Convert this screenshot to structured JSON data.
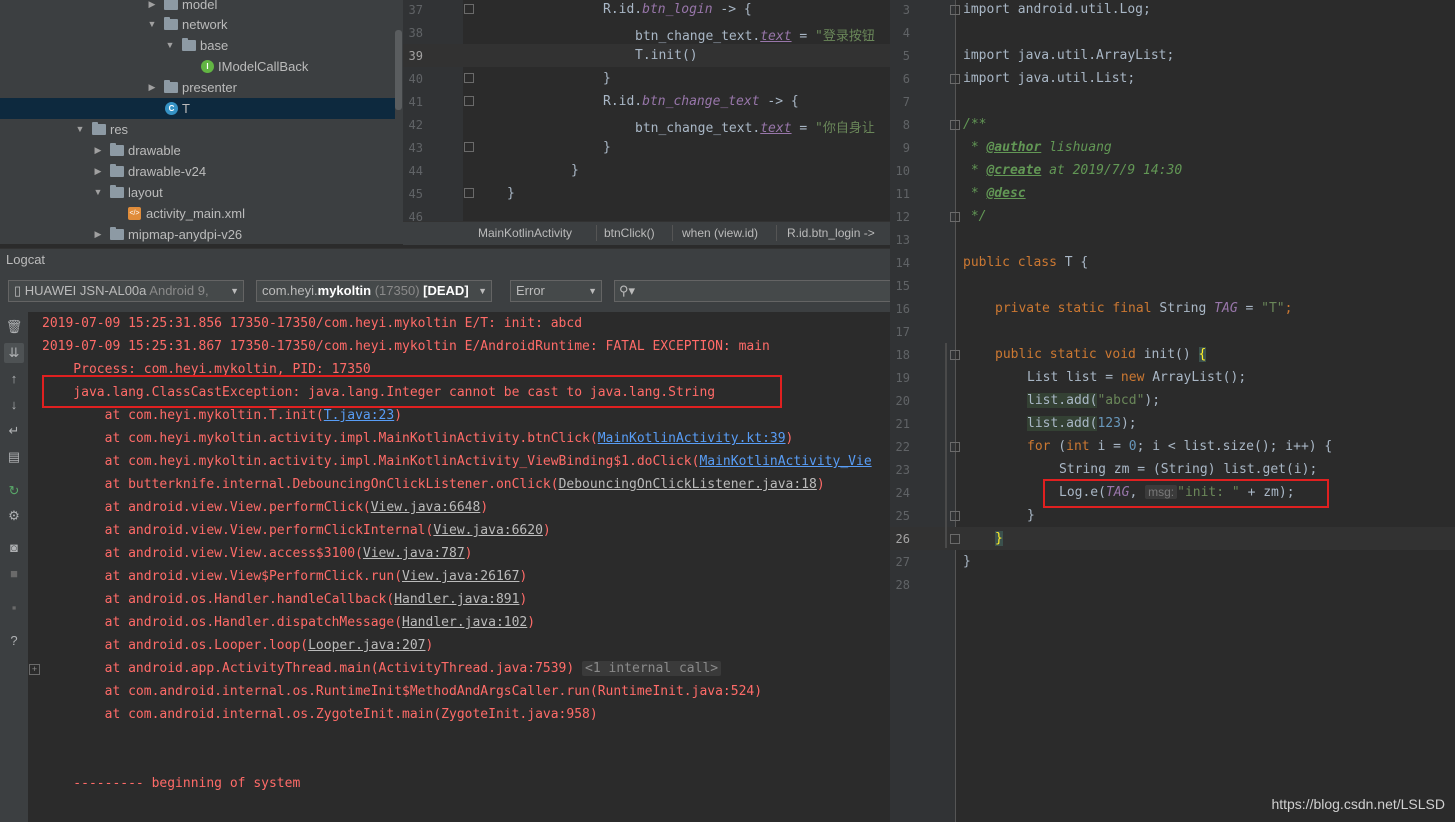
{
  "project_tree": {
    "items": [
      {
        "label": "model",
        "type": "folder",
        "expanded": false
      },
      {
        "label": "network",
        "type": "folder",
        "expanded": true
      },
      {
        "label": "base",
        "type": "folder",
        "expanded": true
      },
      {
        "label": "IModelCallBack",
        "type": "interface"
      },
      {
        "label": "presenter",
        "type": "folder",
        "expanded": false
      },
      {
        "label": "T",
        "type": "class",
        "selected": true
      },
      {
        "label": "res",
        "type": "res-folder",
        "expanded": true
      },
      {
        "label": "drawable",
        "type": "folder",
        "expanded": false
      },
      {
        "label": "drawable-v24",
        "type": "folder",
        "expanded": false
      },
      {
        "label": "layout",
        "type": "folder",
        "expanded": true
      },
      {
        "label": "activity_main.xml",
        "type": "xml"
      },
      {
        "label": "mipmap-anydpi-v26",
        "type": "folder",
        "expanded": false
      }
    ]
  },
  "top_editor": {
    "line_numbers": [
      "37",
      "38",
      "39",
      "40",
      "41",
      "42",
      "43",
      "44",
      "45",
      "46"
    ],
    "lines": [
      {
        "a": "R.id.",
        "b": "btn_login",
        "c": " -> {"
      },
      {
        "a": "btn_change_text.",
        "b": "text",
        "c": " = ",
        "d": "\"登录按钮"
      },
      {
        "a": "T.init()"
      },
      {
        "a": "}"
      },
      {
        "a": "R.id.",
        "b": "btn_change_text",
        "c": " -> {"
      },
      {
        "a": "btn_change_text.",
        "b": "text",
        "c": " = ",
        "d": "\"你自身让"
      },
      {
        "a": "}"
      },
      {
        "a": "}"
      },
      {
        "a": "}"
      },
      {
        "a": ""
      }
    ],
    "breadcrumbs": [
      "MainKotlinActivity",
      "btnClick()",
      "when (view.id)",
      "R.id.btn_login ->"
    ]
  },
  "logcat": {
    "title": "Logcat",
    "device": {
      "name": "HUAWEI JSN-AL00a",
      "detail": "Android 9, "
    },
    "process": {
      "prefix": "com.heyi.",
      "bold": "mykoltin",
      "pid": " (17350) ",
      "state": "[DEAD]"
    },
    "level": "Error",
    "search_placeholder": "",
    "lines": [
      {
        "text": "2019-07-09 15:25:31.856 17350-17350/com.heyi.mykoltin E/T: init: abcd"
      },
      {
        "text": "2019-07-09 15:25:31.867 17350-17350/com.heyi.mykoltin E/AndroidRuntime: FATAL EXCEPTION: main"
      },
      {
        "text": "    Process: com.heyi.mykoltin, PID: 17350"
      },
      {
        "text": "    java.lang.ClassCastException: java.lang.Integer cannot be cast to java.lang.String"
      },
      {
        "text": "        at com.heyi.mykoltin.T.init(",
        "link": "T.java:23",
        "tail": ")"
      },
      {
        "text": "        at com.heyi.mykoltin.activity.impl.MainKotlinActivity.btnClick(",
        "link": "MainKotlinActivity.kt:39",
        "tail": ")"
      },
      {
        "text": "        at com.heyi.mykoltin.activity.impl.MainKotlinActivity_ViewBinding$1.doClick(",
        "link": "MainKotlinActivity_Vie",
        "tail": ""
      },
      {
        "text": "        at butterknife.internal.DebouncingOnClickListener.onClick(",
        "src": "DebouncingOnClickListener.java:18",
        "tail": ")"
      },
      {
        "text": "        at android.view.View.performClick(",
        "src": "View.java:6648",
        "tail": ")"
      },
      {
        "text": "        at android.view.View.performClickInternal(",
        "src": "View.java:6620",
        "tail": ")"
      },
      {
        "text": "        at android.view.View.access$3100(",
        "src": "View.java:787",
        "tail": ")"
      },
      {
        "text": "        at android.view.View$PerformClick.run(",
        "src": "View.java:26167",
        "tail": ")"
      },
      {
        "text": "        at android.os.Handler.handleCallback(",
        "src": "Handler.java:891",
        "tail": ")"
      },
      {
        "text": "        at android.os.Handler.dispatchMessage(",
        "src": "Handler.java:102",
        "tail": ")"
      },
      {
        "text": "        at android.os.Looper.loop(",
        "src": "Looper.java:207",
        "tail": ")"
      },
      {
        "text": "        at android.app.ActivityThread.main(ActivityThread.java:7539) ",
        "fold": "<1 internal call>"
      },
      {
        "text": "        at com.android.internal.os.RuntimeInit$MethodAndArgsCaller.run(RuntimeInit.java:524)"
      },
      {
        "text": "        at com.android.internal.os.ZygoteInit.main(ZygoteInit.java:958)"
      }
    ],
    "footer": "    --------- beginning of system"
  },
  "right_editor": {
    "line_numbers": [
      "3",
      "4",
      "5",
      "6",
      "7",
      "8",
      "9",
      "10",
      "11",
      "12",
      "13",
      "14",
      "15",
      "16",
      "17",
      "18",
      "19",
      "20",
      "21",
      "22",
      "23",
      "24",
      "25",
      "26",
      "27",
      "28"
    ],
    "l3": "import android.util.Log;",
    "l5": "import java.util.ArrayList;",
    "l6": "import java.util.List;",
    "l8": "/**",
    "l9_tag": "@author",
    "l9_rest": " lishuang",
    "l10_tag": "@create",
    "l10_rest": " at 2019/7/9 14:30",
    "l11_tag": "@desc",
    "l12": " */",
    "l14_kw": "public class",
    "l14_rest": " T {",
    "l16_kw": "private static final",
    "l16_type": " String ",
    "l16_field": "TAG",
    "l16_eq": " = ",
    "l16_str": "\"T\"",
    "l18_kw": "public static void",
    "l18_rest": " init() ",
    "l18_brace": "{",
    "l19_a": "List list = ",
    "l19_kw": "new",
    "l19_b": " ArrayList();",
    "l20_a": "list.add(",
    "l20_str": "\"abcd\"",
    "l20_b": ");",
    "l21_a": "list.add(",
    "l21_num": "123",
    "l21_b": ");",
    "l22_kw": "for",
    "l22_a": " (",
    "l22_kw2": "int",
    "l22_b": " i = ",
    "l22_num": "0",
    "l22_c": "; i < list.size(); i++) {",
    "l23": "String zm = (String) list.get(i);",
    "l24_a": "Log.e(",
    "l24_field": "TAG",
    "l24_b": ", ",
    "l24_hint": "msg:",
    "l24_str": "\"init: \"",
    "l24_c": " + zm);",
    "l25": "}",
    "l26": "}",
    "l27": "}",
    "watermark": "https://blog.csdn.net/LSLSD"
  }
}
